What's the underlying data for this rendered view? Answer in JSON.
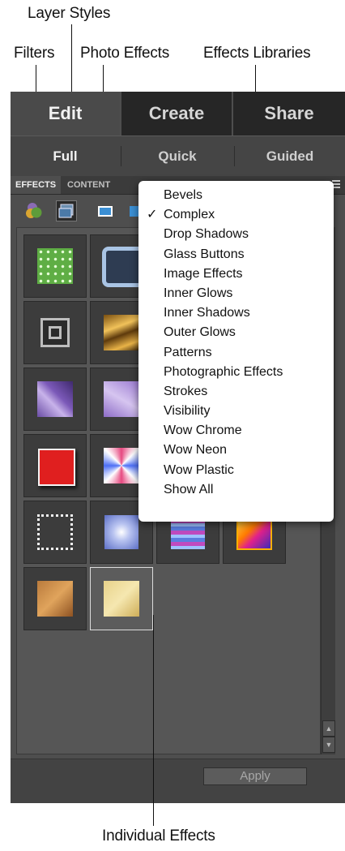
{
  "callouts": {
    "layer_styles": "Layer Styles",
    "filters": "Filters",
    "photo_effects": "Photo Effects",
    "effects_libraries": "Effects Libraries",
    "individual_effects": "Individual Effects"
  },
  "tabs": [
    "Edit",
    "Create",
    "Share"
  ],
  "subtabs": [
    "Full",
    "Quick",
    "Guided"
  ],
  "panel_tabs": [
    "EFFECTS",
    "CONTENT"
  ],
  "toolbar_icons": [
    "filters-icon",
    "layer-styles-icon",
    "photo-effects-icon",
    "show-all-icon"
  ],
  "dropdown": {
    "selected": "Complex",
    "check": "✓",
    "items": [
      "Bevels",
      "Complex",
      "Drop Shadows",
      "Glass Buttons",
      "Image Effects",
      "Inner Glows",
      "Inner Shadows",
      "Outer Glows",
      "Patterns",
      "Photographic Effects",
      "Strokes",
      "Visibility",
      "Wow Chrome",
      "Wow Neon",
      "Wow Plastic",
      "Show All"
    ]
  },
  "apply_label": "Apply",
  "scroll_arrows": {
    "up": "▲",
    "down": "▼"
  },
  "colors": {
    "panel_bg": "#4e4e4e",
    "inactive_tab": "#262626",
    "menu_bg": "#ffffff",
    "selected_thumb_border": "#dcdcdc"
  }
}
